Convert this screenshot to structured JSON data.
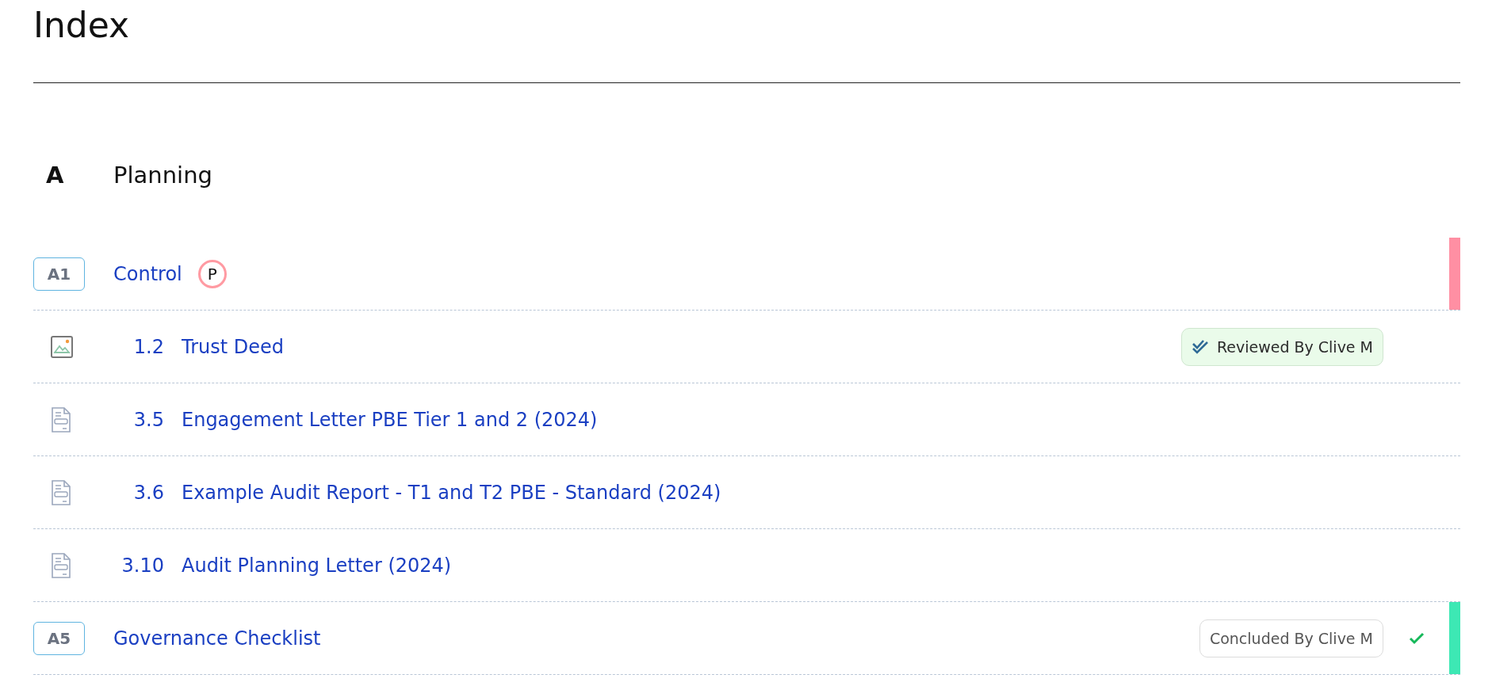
{
  "page": {
    "title": "Index"
  },
  "sections": [
    {
      "letter": "A",
      "title": "Planning",
      "groups": [
        {
          "code": "A1",
          "title": "Control",
          "marker": {
            "text": "P",
            "color": "#ff9aa2"
          },
          "done": false,
          "color": "#ff8fa3",
          "items": [
            {
              "kind": "image",
              "number": "1.2",
              "title": "Trust Deed",
              "badge": {
                "kind": "reviewed",
                "text": "Reviewed By Clive M"
              }
            },
            {
              "kind": "document",
              "number": "3.5",
              "title": "Engagement Letter PBE Tier 1 and 2 (2024)"
            },
            {
              "kind": "document",
              "number": "3.6",
              "title": "Example Audit Report - T1 and T2 PBE - Standard (2024)"
            },
            {
              "kind": "document",
              "number": "3.10",
              "title": "Audit Planning Letter (2024)"
            }
          ]
        },
        {
          "code": "A5",
          "title": "Governance Checklist",
          "badge": {
            "kind": "concluded",
            "text": "Concluded By Clive M"
          },
          "done": true,
          "color": "#3de8b4"
        }
      ]
    }
  ]
}
